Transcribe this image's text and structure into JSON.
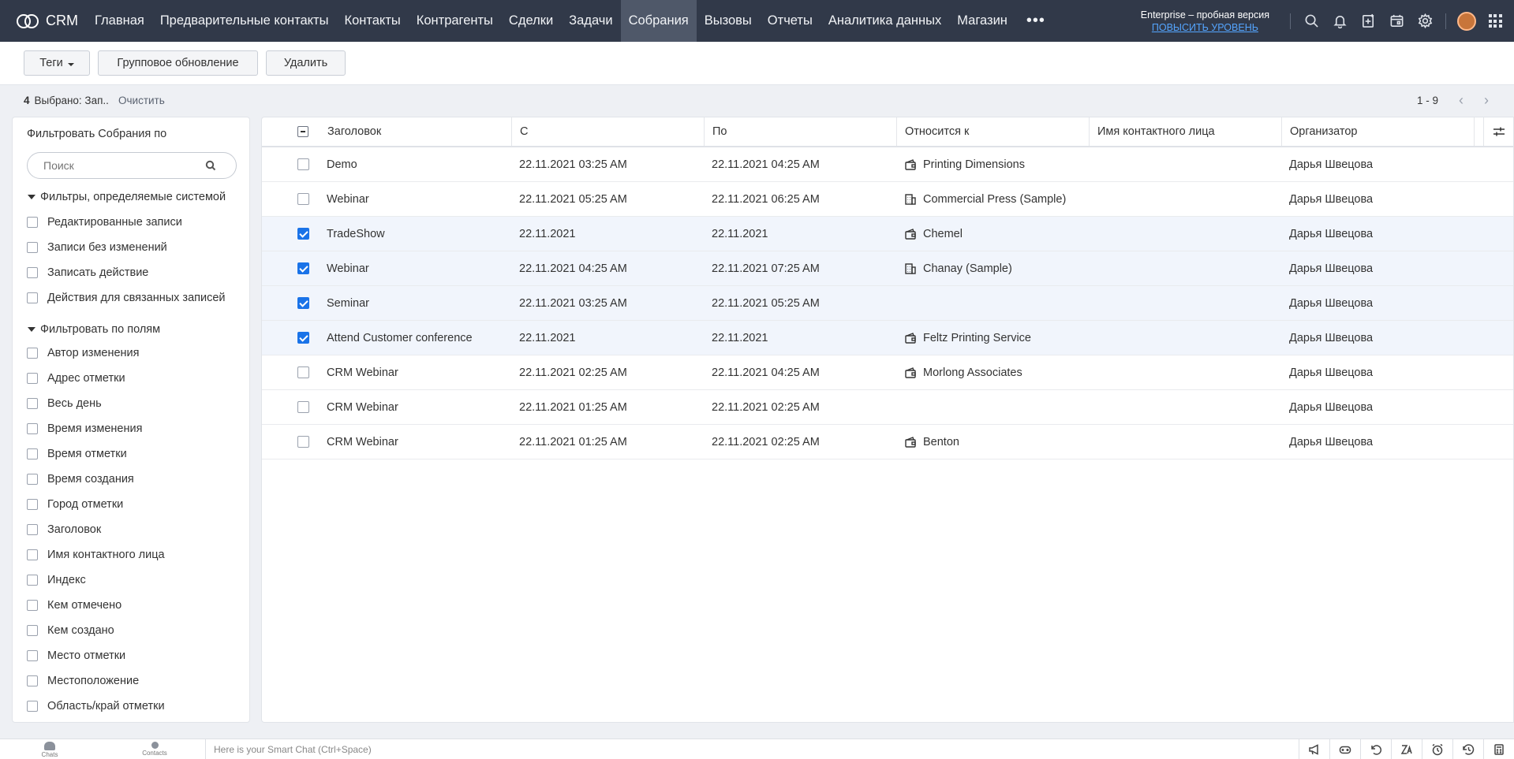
{
  "app": {
    "name": "CRM"
  },
  "nav": {
    "items": [
      {
        "label": "Главная"
      },
      {
        "label": "Предварительные контакты"
      },
      {
        "label": "Контакты"
      },
      {
        "label": "Контрагенты"
      },
      {
        "label": "Сделки"
      },
      {
        "label": "Задачи"
      },
      {
        "label": "Собрания",
        "active": true
      },
      {
        "label": "Вызовы"
      },
      {
        "label": "Отчеты"
      },
      {
        "label": "Аналитика данных"
      },
      {
        "label": "Магазин"
      }
    ],
    "more_label": "•••",
    "trial_text": "Enterprise – пробная версия",
    "upgrade_text": "ПОВЫСИТЬ УРОВЕНЬ"
  },
  "toolbar": {
    "tags_label": "Теги",
    "mass_update_label": "Групповое обновление",
    "delete_label": "Удалить"
  },
  "selection": {
    "count": "4",
    "text": "Выбрано: Зап..",
    "clear_label": "Очистить",
    "page_range": "1 - 9"
  },
  "filters": {
    "title": "Фильтровать Собрания по",
    "search_placeholder": "Поиск",
    "system_group_label": "Фильтры, определяемые системой",
    "system_items": [
      "Редактированные записи",
      "Записи без изменений",
      "Записать действие",
      "Действия для связанных записей"
    ],
    "field_group_label": "Фильтровать по полям",
    "field_items": [
      "Автор изменения",
      "Адрес отметки",
      "Весь день",
      "Время изменения",
      "Время отметки",
      "Время создания",
      "Город отметки",
      "Заголовок",
      "Имя контактного лица",
      "Индекс",
      "Кем отмечено",
      "Кем создано",
      "Место отметки",
      "Местоположение",
      "Область/край отметки"
    ]
  },
  "table": {
    "columns": [
      "Заголовок",
      "С",
      "По",
      "Относится к",
      "Имя контактного лица",
      "Организатор"
    ],
    "rows": [
      {
        "title": "Demo",
        "from": "22.11.2021 03:25 AM",
        "to": "22.11.2021 04:25 AM",
        "related": "Printing Dimensions",
        "related_icon": "wallet-icon",
        "contact": "",
        "host": "Дарья Швецова",
        "selected": false
      },
      {
        "title": "Webinar",
        "from": "22.11.2021 05:25 AM",
        "to": "22.11.2021 06:25 AM",
        "related": "Commercial Press (Sample)",
        "related_icon": "building-icon",
        "contact": "",
        "host": "Дарья Швецова",
        "selected": false
      },
      {
        "title": "TradeShow",
        "from": "22.11.2021",
        "to": "22.11.2021",
        "related": "Chemel",
        "related_icon": "wallet-icon",
        "contact": "",
        "host": "Дарья Швецова",
        "selected": true
      },
      {
        "title": "Webinar",
        "from": "22.11.2021 04:25 AM",
        "to": "22.11.2021 07:25 AM",
        "related": "Chanay (Sample)",
        "related_icon": "building-icon",
        "contact": "",
        "host": "Дарья Швецова",
        "selected": true
      },
      {
        "title": "Seminar",
        "from": "22.11.2021 03:25 AM",
        "to": "22.11.2021 05:25 AM",
        "related": "",
        "related_icon": "",
        "contact": "",
        "host": "Дарья Швецова",
        "selected": true
      },
      {
        "title": "Attend Customer conference",
        "from": "22.11.2021",
        "to": "22.11.2021",
        "related": "Feltz Printing Service",
        "related_icon": "wallet-icon",
        "contact": "",
        "host": "Дарья Швецова",
        "selected": true
      },
      {
        "title": "CRM Webinar",
        "from": "22.11.2021 02:25 AM",
        "to": "22.11.2021 04:25 AM",
        "related": "Morlong Associates",
        "related_icon": "wallet-icon",
        "contact": "",
        "host": "Дарья Швецова",
        "selected": false
      },
      {
        "title": "CRM Webinar",
        "from": "22.11.2021 01:25 AM",
        "to": "22.11.2021 02:25 AM",
        "related": "",
        "related_icon": "",
        "contact": "",
        "host": "Дарья Швецова",
        "selected": false
      },
      {
        "title": "CRM Webinar",
        "from": "22.11.2021 01:25 AM",
        "to": "22.11.2021 02:25 AM",
        "related": "Benton",
        "related_icon": "wallet-icon",
        "contact": "",
        "host": "Дарья Швецова",
        "selected": false
      }
    ]
  },
  "bottombar": {
    "chats_label": "Chats",
    "contacts_label": "Contacts",
    "smart_chat_placeholder": "Here is your Smart Chat (Ctrl+Space)"
  },
  "colors": {
    "nav_bg": "#313949",
    "nav_active": "#4f5869",
    "accent": "#1a73e8",
    "upgrade_link": "#54a5ff",
    "selected_row": "#f1f5fc"
  }
}
